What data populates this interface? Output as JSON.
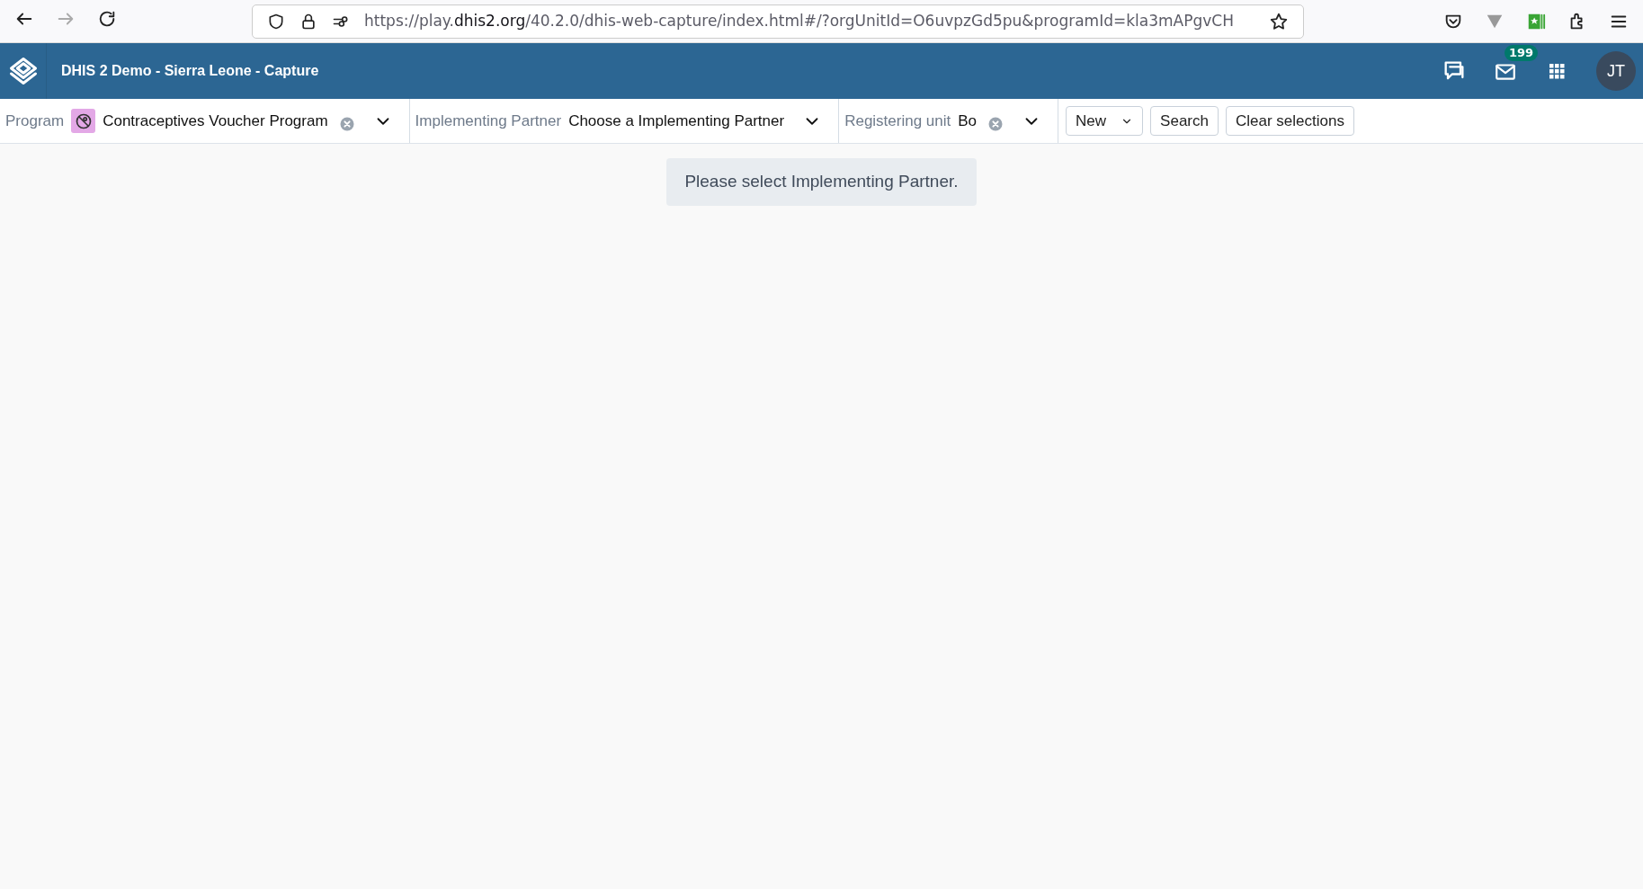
{
  "browser": {
    "address_bar": {
      "parts": [
        {
          "text": "https://play.",
          "emphasis": false
        },
        {
          "text": "dhis2.org",
          "emphasis": true
        },
        {
          "text": "/40.2.0/dhis-web-capture/index.html#/?orgUnitId=O6uvpzGd5pu&programId=kla3mAPgvCH",
          "emphasis": false
        }
      ]
    }
  },
  "header": {
    "title": "DHIS 2 Demo - Sierra Leone - Capture",
    "messages_badge": "199",
    "avatar": "JT"
  },
  "filters": [
    {
      "label": "Program",
      "value": "Contraceptives Voucher Program",
      "has_icon": true,
      "clearable": true
    },
    {
      "label": "Implementing Partner",
      "value": "Choose a Implementing Partner",
      "has_icon": false,
      "clearable": false
    },
    {
      "label": "Registering unit",
      "value": "Bo",
      "has_icon": false,
      "clearable": true
    }
  ],
  "actions": [
    {
      "label": "New",
      "kind": "dropdown"
    },
    {
      "label": "Search",
      "kind": "button"
    },
    {
      "label": "Clear selections",
      "kind": "button"
    }
  ],
  "message": "Please select Implementing Partner."
}
